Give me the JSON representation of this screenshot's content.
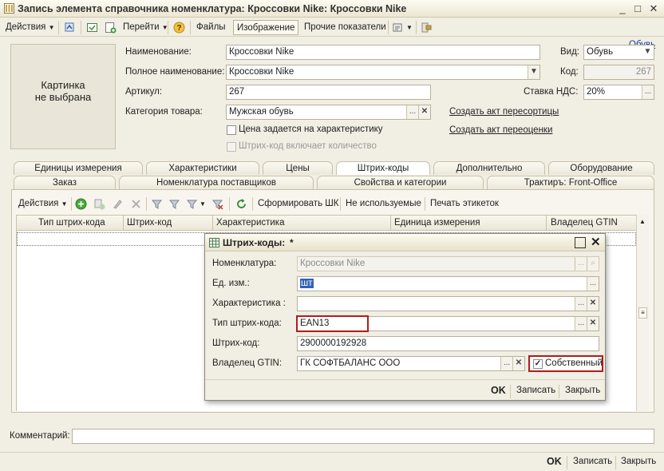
{
  "window": {
    "title": "Запись элемента справочника номенклатура: Кроссовки Nike: Кроссовки Nike",
    "buttons": [
      "_",
      "□",
      "✕"
    ]
  },
  "toolbar": {
    "actions": "Действия",
    "goto": "Перейти",
    "files": "Файлы",
    "image": "Изображение",
    "other": "Прочие показатели",
    "help_link": "Обувь",
    "help_q": "?"
  },
  "picture": {
    "text_line1": "Картинка",
    "text_line2": "не выбрана"
  },
  "form": {
    "name_label": "Наименование:",
    "name_value": "Кроссовки Nike",
    "fullname_label": "Полное наименование:",
    "fullname_value": "Кроссовки Nike",
    "article_label": "Артикул:",
    "article_value": "267",
    "category_label": "Категория товара:",
    "category_value": "Мужская обувь",
    "char_price_label": "Цена задается на характеристику",
    "barcode_qty_label": "Штрих-код включает количество",
    "kind_label": "Вид:",
    "kind_value": "Обувь",
    "code_label": "Код:",
    "code_value": "267",
    "vat_label": "Ставка НДС:",
    "vat_value": "20%",
    "link_regrade": "Создать акт пересортицы",
    "link_revalue": "Создать акт переоценки"
  },
  "tabs_row1": [
    "Единицы измерения",
    "Характеристики",
    "Цены",
    "Штрих-коды",
    "Дополнительно",
    "Оборудование"
  ],
  "tabs_row2": [
    "Заказ",
    "Номенклатура поставщиков",
    "Свойства и категории",
    "Трактиръ: Front-Office"
  ],
  "barcode_toolbar": {
    "actions": "Действия",
    "form_barcode": "Сформировать ШК",
    "unused": "Не используемые",
    "print_labels": "Печать этикеток"
  },
  "table": {
    "columns": [
      "Тип штрих-кода",
      "Штрих-код",
      "Характеристика",
      "Единица измерения",
      "Владелец GTIN"
    ]
  },
  "dialog": {
    "title": "Штрих-коды:",
    "title_mark": "*",
    "nomen_label": "Номенклатура:",
    "nomen_value": "Кроссовки Nike",
    "unit_label": "Ед. изм.:",
    "unit_value": "шт",
    "char_label": "Характеристика :",
    "char_value": "",
    "type_label": "Тип штрих-кода:",
    "type_value": "EAN13",
    "code_label": "Штрих-код:",
    "code_value": "2900000192928",
    "owner_label": "Владелец GTIN:",
    "owner_value": "ГК СОФТБАЛАНС ООО",
    "own_label": "Собственный",
    "ok": "OK",
    "save": "Записать",
    "close": "Закрыть"
  },
  "footer": {
    "comment_label": "Комментарий:",
    "comment_value": "",
    "ok": "OK",
    "save": "Записать",
    "close": "Закрыть"
  },
  "colors": {
    "accent_red": "#b31b1b",
    "link_blue": "#1a3d9c",
    "background": "#f1eee3"
  }
}
